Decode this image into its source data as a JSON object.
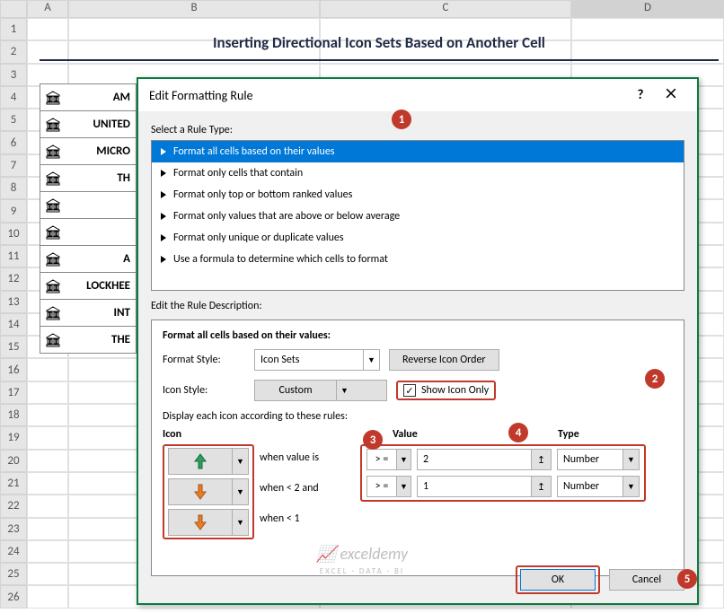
{
  "sheet": {
    "columns": [
      "A",
      "B",
      "C",
      "D"
    ],
    "row_numbers": [
      "1",
      "2",
      "3",
      "4",
      "5",
      "6",
      "7",
      "8",
      "9",
      "10",
      "11",
      "12",
      "13",
      "14",
      "15",
      "16",
      "17",
      "18",
      "19",
      "20",
      "21",
      "22",
      "23",
      "24",
      "25",
      "26"
    ],
    "title": "Inserting Directional Icon Sets Based on Another Cell",
    "rows": [
      "AM",
      "UNITED",
      "MICRO",
      "TH",
      "",
      "",
      "A",
      "LOCKHEE",
      "INT",
      "THE "
    ]
  },
  "dialog": {
    "title": "Edit Formatting Rule",
    "select_label": "Select a Rule Type:",
    "rule_types": [
      "Format all cells based on their values",
      "Format only cells that contain",
      "Format only top or bottom ranked values",
      "Format only values that are above or below average",
      "Format only unique or duplicate values",
      "Use a formula to determine which cells to format"
    ],
    "edit_desc_label": "Edit the Rule Description:",
    "desc_heading": "Format all cells based on their values:",
    "format_style_label": "Format Style:",
    "format_style_value": "Icon Sets",
    "reverse_btn": "Reverse Icon Order",
    "icon_style_label": "Icon Style:",
    "icon_style_value": "Custom",
    "show_icon_only": "Show Icon Only",
    "display_rules_label": "Display each icon according to these rules:",
    "headers": {
      "icon": "Icon",
      "value": "Value",
      "type": "Type"
    },
    "conditions": {
      "c1": "when value is",
      "c2": "when < 2 and",
      "c3": "when < 1"
    },
    "ops": {
      "o1": "> =",
      "o2": "> ="
    },
    "values": {
      "v1": "2",
      "v2": "1"
    },
    "types": {
      "t1": "Number",
      "t2": "Number"
    },
    "ok": "OK",
    "cancel": "Cancel"
  },
  "badges": {
    "b1": "1",
    "b2": "2",
    "b3": "3",
    "b4": "4",
    "b5": "5"
  },
  "watermark": {
    "brand": "exceldemy",
    "tag": "EXCEL · DATA · BI"
  }
}
